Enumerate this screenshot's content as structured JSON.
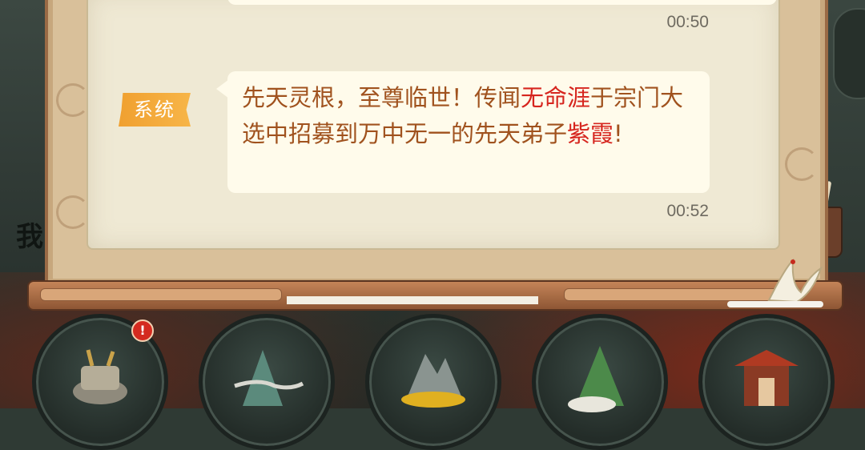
{
  "chat": {
    "messages": [
      {
        "time": "00:50"
      },
      {
        "sender": "系统",
        "segments": [
          {
            "text": "先天灵根，至尊临世！传闻",
            "highlight": false
          },
          {
            "text": "无命涯",
            "highlight": true
          },
          {
            "text": "于宗门大选中招募到万中无一的先天弟子",
            "highlight": false
          },
          {
            "text": "紫霞",
            "highlight": true
          },
          {
            "text": "!",
            "highlight": false
          }
        ],
        "time": "00:52"
      }
    ]
  },
  "left_glyph": "我",
  "bottom_nav": {
    "buttons": [
      {
        "icon": "cauldron-icon",
        "has_notification": true,
        "notification": "!"
      },
      {
        "icon": "mountain-mist-icon",
        "has_notification": false
      },
      {
        "icon": "golden-peak-icon",
        "has_notification": false
      },
      {
        "icon": "green-peak-cloud-icon",
        "has_notification": false
      },
      {
        "icon": "pavilion-icon",
        "has_notification": false
      }
    ]
  },
  "colors": {
    "message_text": "#a0521e",
    "highlight_text": "#d6251e",
    "badge": "#f0a030",
    "bubble": "#fffbeb",
    "panel": "#efe9d4"
  }
}
